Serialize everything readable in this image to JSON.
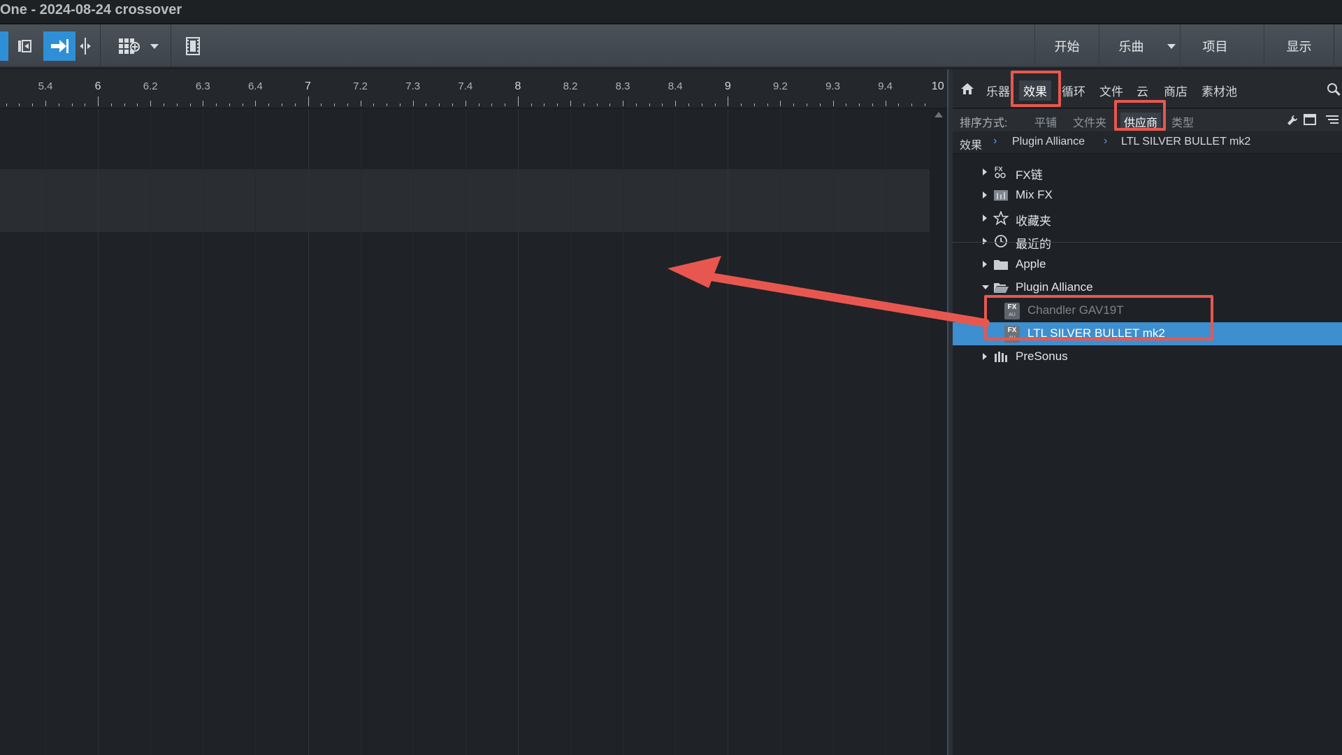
{
  "window": {
    "title": "One - 2024-08-24 crossover"
  },
  "toolbar": {
    "menu": [
      {
        "label": "开始"
      },
      {
        "label": "乐曲"
      },
      {
        "label": "项目"
      },
      {
        "label": "显示"
      }
    ]
  },
  "ruler": {
    "ticks": [
      "5.4",
      "6",
      "6.2",
      "6.3",
      "6.4",
      "7",
      "7.2",
      "7.3",
      "7.4",
      "8",
      "8.2",
      "8.3",
      "8.4",
      "9",
      "9.2",
      "9.3",
      "9.4",
      "10"
    ]
  },
  "browser": {
    "tabs": [
      "乐器",
      "效果",
      "循环",
      "文件",
      "云",
      "商店",
      "素材池"
    ],
    "active_tab": "效果",
    "sort": {
      "label": "排序方式:",
      "options": [
        "平铺",
        "文件夹",
        "供应商",
        "类型"
      ],
      "active": "供应商"
    },
    "breadcrumb": [
      "效果",
      "Plugin Alliance",
      "LTL SILVER BULLET mk2"
    ],
    "tree": [
      {
        "label": "FX链",
        "icon": "fx-chain-icon"
      },
      {
        "label": "Mix FX",
        "icon": "mixfx-icon"
      },
      {
        "label": "收藏夹",
        "icon": "star-icon"
      },
      {
        "label": "最近的",
        "icon": "clock-icon"
      },
      {
        "label": "Apple",
        "icon": "folder-icon"
      },
      {
        "label": "Plugin Alliance",
        "icon": "folder-open-icon"
      },
      {
        "label": "Chandler GAV19T",
        "icon": "fx-plugin-icon"
      },
      {
        "label": "LTL SILVER BULLET mk2",
        "icon": "fx-plugin-icon"
      },
      {
        "label": "PreSonus",
        "icon": "presonus-icon"
      }
    ],
    "fx_badge": {
      "top": "FX",
      "bottom": "AU"
    }
  },
  "colors": {
    "selection": "#3d8fcf",
    "annotation": "#e8574f",
    "active_tool": "#2f8fd6"
  }
}
